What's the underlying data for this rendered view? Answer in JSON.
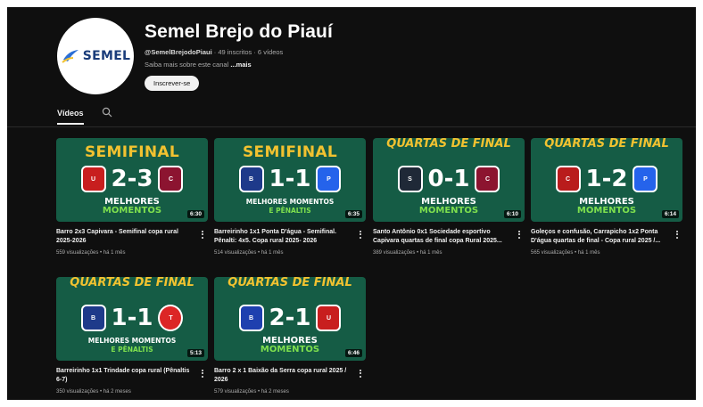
{
  "channel": {
    "logo_text": "SEMEL",
    "name": "Semel Brejo do Piauí",
    "handle": "@SemelBrejodoPiaui",
    "stats": " · 49 inscritos · 6 vídeos",
    "about": "Saiba mais sobre este canal ",
    "about_more": "...mais",
    "subscribe_label": "Inscrever-se"
  },
  "tabs": {
    "videos": "Vídeos"
  },
  "icons": {
    "search": "search-icon",
    "menu": "more-vert-icon"
  },
  "colors": {
    "accent_yellow": "#f2c230",
    "accent_green": "#7ee04e",
    "thumb_bg": "#155c45"
  },
  "videos": [
    {
      "thumb": {
        "stage": "SEMIFINAL",
        "score": "2-3",
        "line1": "MELHORES",
        "line2": "MOMENTOS",
        "duration": "6:30"
      },
      "title": "Barro 2x3 Capivara - Semifinal copa rural 2025-2026",
      "meta": "559 visualizações • há 1 mês"
    },
    {
      "thumb": {
        "stage": "SEMIFINAL",
        "score": "1-1",
        "line1": "MELHORES MOMENTOS",
        "line2": "E PÊNALTIS",
        "duration": "6:35"
      },
      "title": "Barreirinho 1x1 Ponta D'água - Semifinal. Pênalti: 4x5. Copa rural 2025- 2026",
      "meta": "514 visualizações • há 1 mês"
    },
    {
      "thumb": {
        "stage": "QUARTAS DE FINAL",
        "score": "0-1",
        "line1": "MELHORES",
        "line2": "MOMENTOS",
        "duration": "6:10"
      },
      "title": "Santo Antônio 0x1 Sociedade esportivo Capivara quartas de final copa Rural 2025...",
      "meta": "389 visualizações • há 1 mês"
    },
    {
      "thumb": {
        "stage": "QUARTAS DE FINAL",
        "score": "1-2",
        "line1": "MELHORES",
        "line2": "MOMENTOS",
        "duration": "6:14"
      },
      "title": "Goleços e confusão, Carrapicho 1x2 Ponta D'água quartas de final - Copa rural 2025 /...",
      "meta": "565 visualizações • há 1 mês"
    },
    {
      "thumb": {
        "stage": "QUARTAS DE FINAL",
        "score": "1-1",
        "line1": "MELHORES MOMENTOS",
        "line2": "E PÊNALTIS",
        "duration": "5:13"
      },
      "title": "Barreirinho 1x1 Trindade copa rural (Pênaltis 6-7)",
      "meta": "350 visualizações • há 2 meses"
    },
    {
      "thumb": {
        "stage": "QUARTAS DE FINAL",
        "score": "2-1",
        "line1": "MELHORES",
        "line2": "MOMENTOS",
        "duration": "6:46"
      },
      "title": "Barro 2 x 1 Baixão da Serra copa rural 2025 / 2026",
      "meta": "579 visualizações • há 2 meses"
    }
  ]
}
